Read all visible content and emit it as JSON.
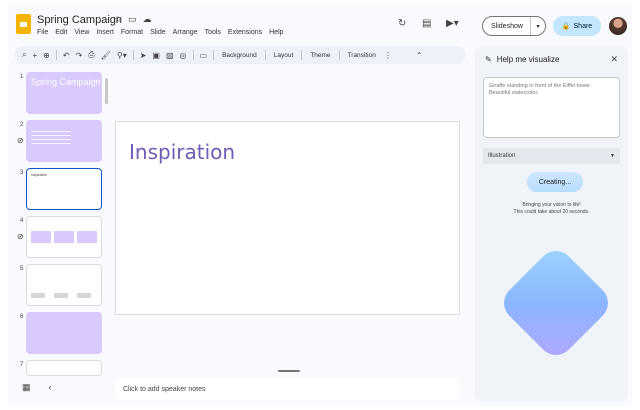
{
  "header": {
    "doc_title": "Spring Campaign",
    "menu": [
      "File",
      "Edit",
      "View",
      "Insert",
      "Format",
      "Slide",
      "Arrange",
      "Tools",
      "Extensions",
      "Help"
    ],
    "slideshow_label": "Slideshow",
    "share_label": "Share"
  },
  "toolbar": {
    "background": "Background",
    "layout": "Layout",
    "theme": "Theme",
    "transition": "Transition"
  },
  "filmstrip": {
    "slides": [
      {
        "num": "1",
        "title": "Spring Campaign"
      },
      {
        "num": "2"
      },
      {
        "num": "3",
        "text": "Inspiration"
      },
      {
        "num": "4"
      },
      {
        "num": "5"
      },
      {
        "num": "6"
      },
      {
        "num": "7"
      }
    ]
  },
  "canvas": {
    "heading": "Inspiration"
  },
  "notes": {
    "placeholder": "Click to add speaker notes"
  },
  "panel": {
    "title": "Help me visualize",
    "prompt": "Giraffe standing in front of the Eiffel tower. Beautiful watercolor.",
    "style": "Illustration",
    "creating_label": "Creating...",
    "msg_line1": "Bringing your vision to life!",
    "msg_line2": "This could take about 20 seconds."
  },
  "colors": {
    "accent": "#0b57d0",
    "share_bg": "#c2e7ff",
    "slide_purple": "#d9c9ff",
    "heading_purple": "#6f5bb5"
  }
}
